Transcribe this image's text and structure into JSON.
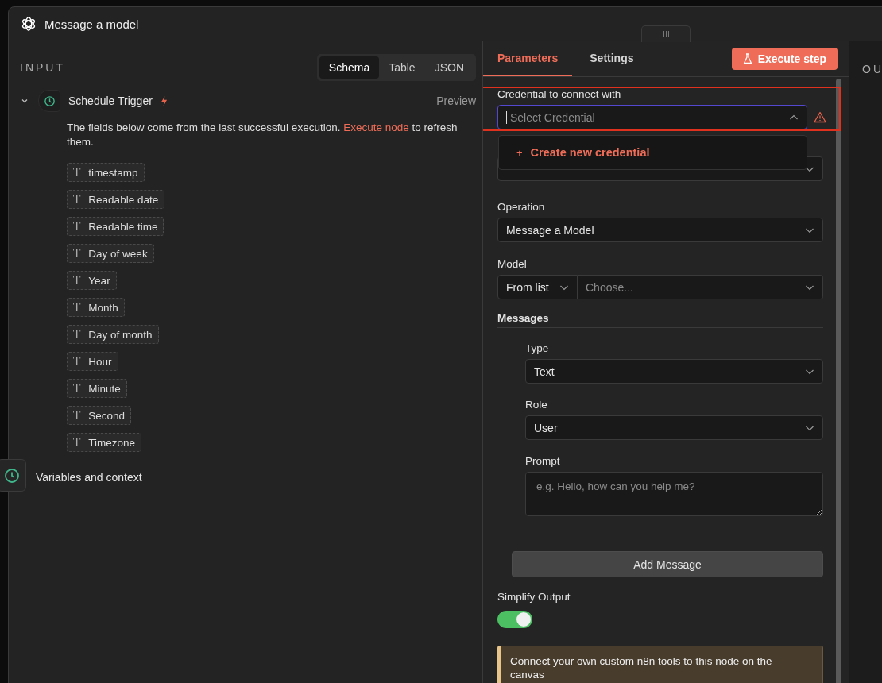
{
  "window": {
    "title": "Message a model"
  },
  "input_panel": {
    "title": "INPUT",
    "view_tabs": [
      {
        "label": "Schema",
        "selected": true
      },
      {
        "label": "Table",
        "selected": false
      },
      {
        "label": "JSON",
        "selected": false
      }
    ],
    "node": {
      "name": "Schedule Trigger",
      "expanded": true,
      "preview": "Preview"
    },
    "notice": {
      "before": "The fields below come from the last successful execution.",
      "link": "Execute node",
      "after": "to refresh them."
    },
    "fields": [
      {
        "type_icon": "T",
        "name": "timestamp"
      },
      {
        "type_icon": "T",
        "name": "Readable date"
      },
      {
        "type_icon": "T",
        "name": "Readable time"
      },
      {
        "type_icon": "T",
        "name": "Day of week"
      },
      {
        "type_icon": "T",
        "name": "Year"
      },
      {
        "type_icon": "T",
        "name": "Month"
      },
      {
        "type_icon": "T",
        "name": "Day of month"
      },
      {
        "type_icon": "T",
        "name": "Hour"
      },
      {
        "type_icon": "T",
        "name": "Minute"
      },
      {
        "type_icon": "T",
        "name": "Second"
      },
      {
        "type_icon": "T",
        "name": "Timezone"
      }
    ],
    "variables": "Variables and context"
  },
  "parameters_panel": {
    "tabs": [
      {
        "label": "Parameters",
        "selected": true
      },
      {
        "label": "Settings",
        "selected": false
      }
    ],
    "execute_button": "Execute step",
    "credential": {
      "label": "Credential to connect with",
      "placeholder": "Select Credential",
      "error": true,
      "highlighted": true,
      "expanded": true
    },
    "credential_menu": {
      "items": [
        {
          "icon": "+",
          "label": "Create new credential"
        }
      ]
    },
    "operation": {
      "label": "Operation",
      "value": "Message a Model"
    },
    "model": {
      "label": "Model",
      "mode": "From list",
      "placeholder": "Choose..."
    },
    "messages": {
      "label": "Messages",
      "items": [
        {
          "type_label": "Type",
          "type": "Text",
          "role_label": "Role",
          "role": "User",
          "prompt_label": "Prompt",
          "prompt_placeholder": "e.g. Hello, how can you help me?"
        }
      ],
      "add_button": "Add Message"
    },
    "simplify_output": {
      "label": "Simplify Output",
      "on": true
    },
    "hint": "Connect your own custom n8n tools to this node on the canvas"
  },
  "output_panel": {
    "title": "OU"
  }
}
